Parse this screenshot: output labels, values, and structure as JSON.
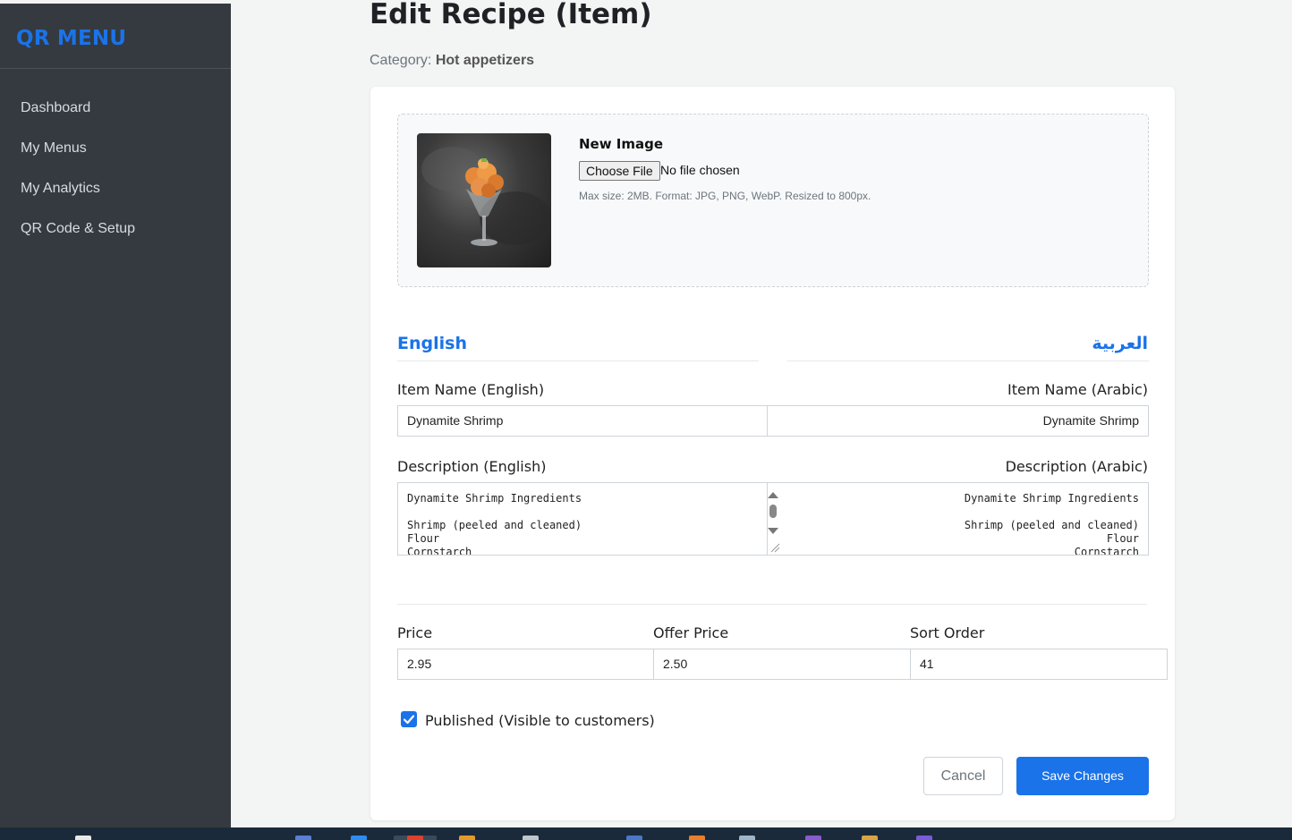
{
  "sidebar": {
    "brand": "QR MENU",
    "items": [
      {
        "label": "Dashboard"
      },
      {
        "label": "My Menus"
      },
      {
        "label": "My Analytics"
      },
      {
        "label": "QR Code & Setup"
      }
    ]
  },
  "page": {
    "title": "Edit Recipe (Item)",
    "category_prefix": "Category:",
    "category_value": "Hot appetizers"
  },
  "image_section": {
    "new_image_label": "New Image",
    "choose_file_label": "Choose File",
    "file_status": "No file chosen",
    "hint": "Max size: 2MB. Format: JPG, PNG, WebP. Resized to 800px."
  },
  "languages": {
    "english_heading": "English",
    "arabic_heading": "العربية"
  },
  "fields": {
    "name_en_label": "Item Name (English)",
    "name_ar_label": "Item Name (Arabic)",
    "name_en_value": "Dynamite Shrimp",
    "name_ar_value": "Dynamite Shrimp",
    "desc_en_label": "Description (English)",
    "desc_ar_label": "Description (Arabic)",
    "desc_en_value": "Dynamite Shrimp Ingredients\n\nShrimp (peeled and cleaned)\nFlour\nCornstarch",
    "desc_ar_value": "Dynamite Shrimp Ingredients\n\nShrimp (peeled and cleaned)\nFlour\nCornstarch",
    "price_label": "Price",
    "price_value": "2.95",
    "offer_label": "Offer Price",
    "offer_value": "2.50",
    "sort_label": "Sort Order",
    "sort_value": "41"
  },
  "published": {
    "label": "Published (Visible to customers)",
    "checked": true
  },
  "actions": {
    "cancel_label": "Cancel",
    "save_label": "Save Changes"
  },
  "colors": {
    "accent": "#1a73e8",
    "sidebar_bg": "#343a40"
  }
}
